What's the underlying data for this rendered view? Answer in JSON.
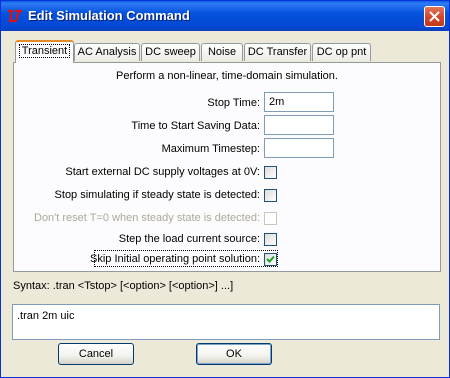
{
  "window": {
    "title": "Edit Simulation Command"
  },
  "tabs": [
    {
      "label": "Transient",
      "active": true
    },
    {
      "label": "AC Analysis",
      "active": false
    },
    {
      "label": "DC sweep",
      "active": false
    },
    {
      "label": "Noise",
      "active": false
    },
    {
      "label": "DC Transfer",
      "active": false
    },
    {
      "label": "DC op pnt",
      "active": false
    }
  ],
  "transient": {
    "description": "Perform a non-linear, time-domain simulation.",
    "fields": [
      {
        "label": "Stop Time:",
        "value": "2m"
      },
      {
        "label": "Time to Start Saving Data:",
        "value": ""
      },
      {
        "label": "Maximum Timestep:",
        "value": ""
      }
    ],
    "options": [
      {
        "label": "Start external DC supply voltages at 0V:",
        "checked": false,
        "enabled": true
      },
      {
        "label": "Stop simulating if steady state is detected:",
        "checked": false,
        "enabled": true
      },
      {
        "label": "Don't reset T=0 when steady state is detected:",
        "checked": false,
        "enabled": false
      },
      {
        "label": "Step the load current source:",
        "checked": false,
        "enabled": true
      },
      {
        "label": "Skip Initial operating point solution:",
        "checked": true,
        "enabled": true
      }
    ]
  },
  "syntax": "Syntax:  .tran <Tstop> [<option> [<option>] ...]",
  "command_text": ".tran 2m uic",
  "buttons": {
    "cancel": "Cancel",
    "ok": "OK"
  },
  "colors": {
    "titlebar": "#0553DD",
    "face": "#ECE9D8",
    "tab_accent": "#E68B2C",
    "close": "#D5482A",
    "check": "#21A121"
  },
  "icons": {
    "app": "ltspice-logo-icon",
    "close": "close-x-icon",
    "check": "checkmark-icon"
  }
}
